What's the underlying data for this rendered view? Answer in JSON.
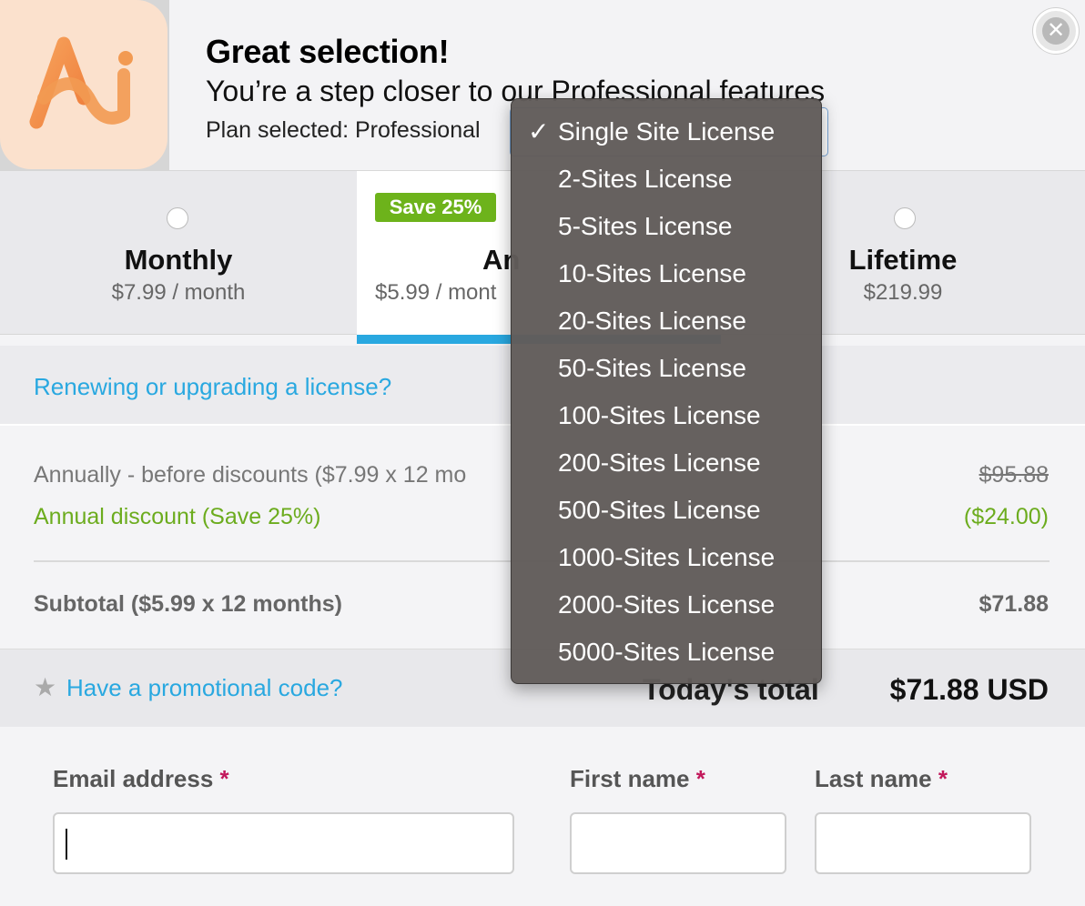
{
  "header": {
    "title": "Great selection!",
    "subtitle": "You’re a step closer to our Professional features",
    "plan_selected": "Plan selected: Professional",
    "close_icon": "close-icon"
  },
  "logo": {
    "letters": "Ai"
  },
  "billing": {
    "badge": "Save 25%",
    "cycles": [
      {
        "name": "Monthly",
        "price": "$7.99 / month"
      },
      {
        "name": "Annually",
        "name_visible": "An",
        "price": "$5.99 / month",
        "price_visible": "$5.99 / mont"
      },
      {
        "name": "Lifetime",
        "price": "$219.99"
      }
    ]
  },
  "renew_link": "Renewing or upgrading a license?",
  "summary": {
    "before_label": "Annually - before discounts ($7.99 x 12 mo",
    "before_value": "$95.88",
    "discount_label": "Annual discount (Save 25%)",
    "discount_value": "($24.00)",
    "subtotal_label": "Subtotal ($5.99 x 12 months)",
    "subtotal_value": "$71.88"
  },
  "total": {
    "promo_link": "Have a promotional code?",
    "label": "Today's total",
    "label_visible": "Today's total",
    "amount": "$71.88 USD"
  },
  "form": {
    "email_label": "Email address",
    "first_label": "First name",
    "last_label": "Last name",
    "required_mark": "*"
  },
  "license_menu": {
    "selected": "Single Site License",
    "items": [
      "Single Site License",
      "2-Sites License",
      "5-Sites License",
      "10-Sites License",
      "20-Sites License",
      "50-Sites License",
      "100-Sites License",
      "200-Sites License",
      "500-Sites License",
      "1000-Sites License",
      "2000-Sites License",
      "5000-Sites License"
    ],
    "check": "✓"
  },
  "colors": {
    "accent": "#29a8e0",
    "green": "#6db31b",
    "required": "#c2185b"
  }
}
